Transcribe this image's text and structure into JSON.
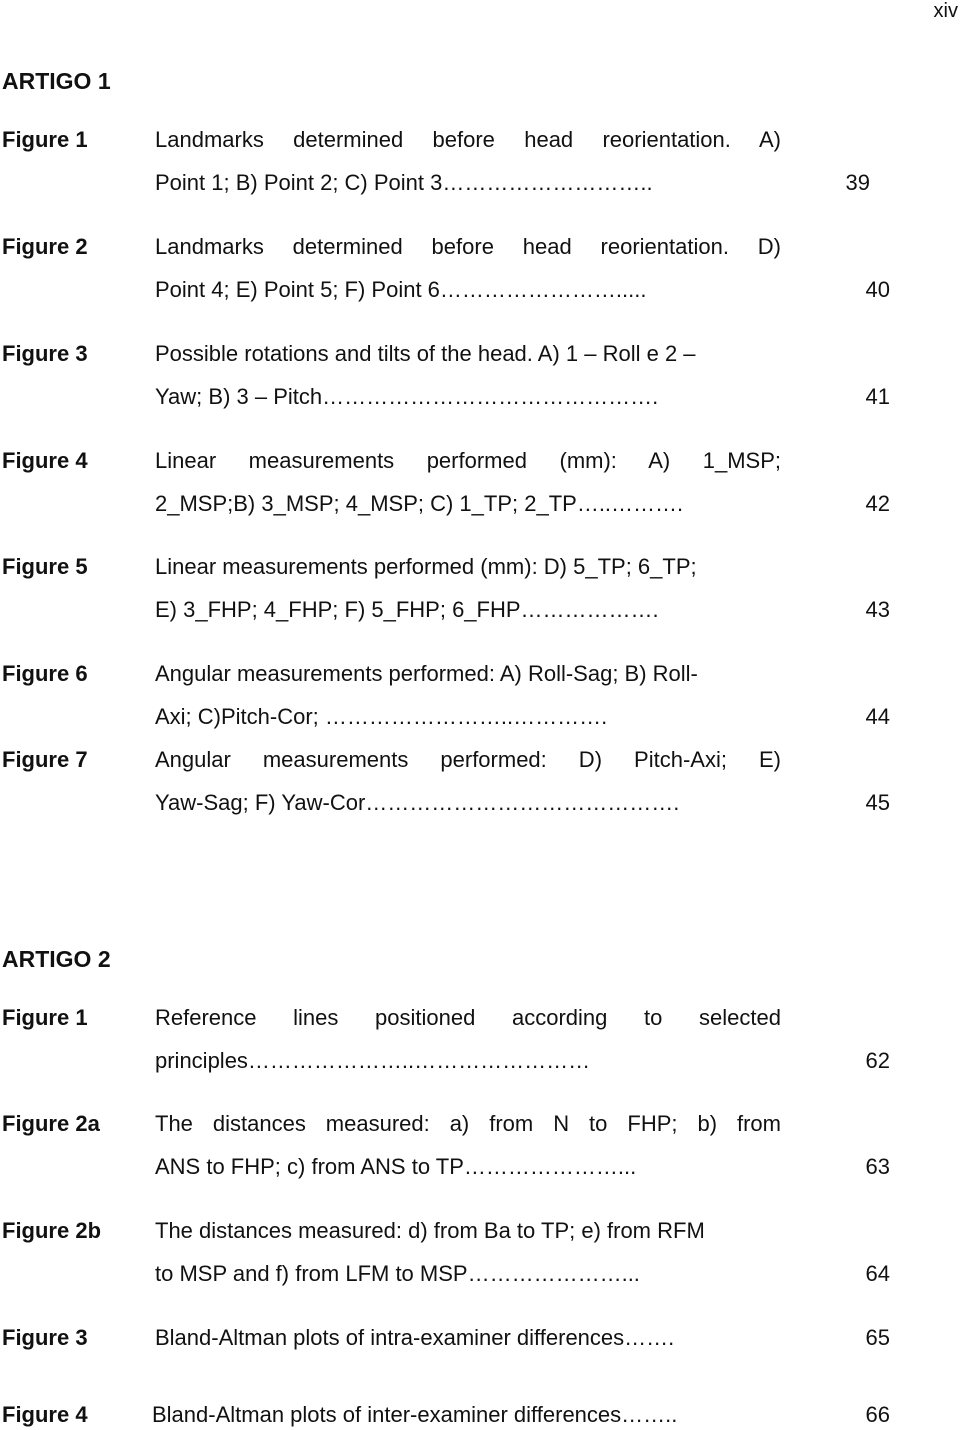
{
  "page_number": "xiv",
  "sections": [
    {
      "title": "ARTIGO 1",
      "entries": [
        {
          "label": "Figure 1",
          "line1": "Landmarks determined before head reorientation. A)",
          "line2": "Point 1; B) Point 2; C) Point 3………………………..",
          "page": "39"
        },
        {
          "label": "Figure 2",
          "line1": "Landmarks determined before head reorientation. D)",
          "line2": "Point 4; E) Point 5; F) Point 6…………………….....",
          "page": "40"
        },
        {
          "label": "Figure 3",
          "line1": "Possible rotations and tilts of the head. A) 1 – Roll e 2 –",
          "line2": "Yaw; B) 3 – Pitch……………………………………….",
          "page": "41"
        },
        {
          "label": "Figure 4",
          "line1": "Linear measurements performed (mm): A) 1_MSP;",
          "line2": "2_MSP;B) 3_MSP; 4_MSP; C) 1_TP; 2_TP…..……….",
          "page": "42"
        },
        {
          "label": "Figure 5",
          "line1": "Linear measurements performed (mm): D) 5_TP; 6_TP;",
          "line2": "E) 3_FHP; 4_FHP; F) 5_FHP; 6_FHP……………….",
          "page": "43"
        },
        {
          "label": "Figure 6",
          "line1": "Angular measurements performed: A) Roll-Sag; B) Roll-",
          "line2": "Axi; C)Pitch-Cor; ……………………..………….",
          "page": "44"
        },
        {
          "label": "Figure 7",
          "line1": "Angular measurements performed: D) Pitch-Axi; E)",
          "line2": "Yaw-Sag; F) Yaw-Cor…………………………………….",
          "page": "45"
        }
      ]
    },
    {
      "title": "ARTIGO 2",
      "entries": [
        {
          "label": "Figure 1",
          "line1": "Reference lines positioned according to selected",
          "line2": "principles…………………..……………………",
          "page": "62"
        },
        {
          "label": "Figure 2a",
          "line1": "The distances measured: a) from N to FHP; b) from",
          "line2": "ANS to FHP; c) from ANS to TP…………………...",
          "page": "63"
        },
        {
          "label": "Figure 2b",
          "line1": "The distances measured: d) from Ba to TP; e) from RFM",
          "line2": "to MSP and f) from LFM to MSP…………………...",
          "page": "64"
        },
        {
          "label": "Figure 3",
          "line1": "Bland-Altman plots of intra-examiner differences…….",
          "page": "65"
        },
        {
          "label": "Figure 4",
          "line1": "Bland-Altman plots of inter-examiner differences……..",
          "page": "66"
        }
      ]
    }
  ]
}
